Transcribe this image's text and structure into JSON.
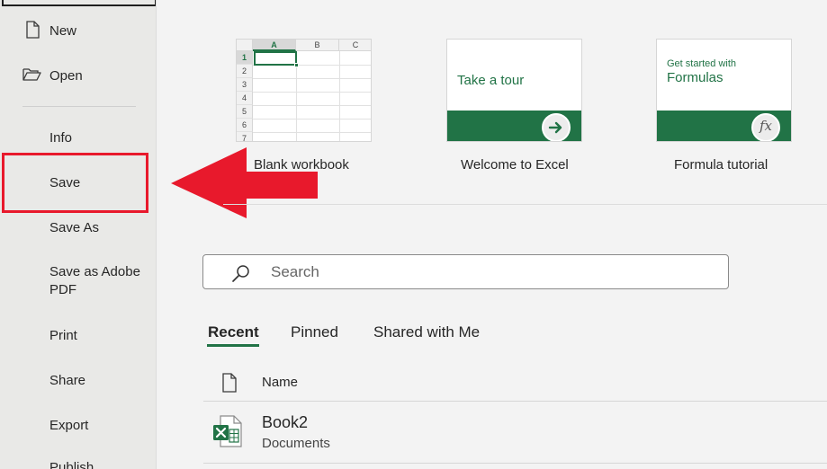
{
  "sidebar": {
    "new_label": "New",
    "open_label": "Open",
    "info_label": "Info",
    "save_label": "Save",
    "save_as_label": "Save As",
    "save_pdf_label": "Save as Adobe PDF",
    "print_label": "Print",
    "share_label": "Share",
    "export_label": "Export",
    "publish_label": "Publish"
  },
  "templates": [
    {
      "label": "Blank workbook"
    },
    {
      "label": "Welcome to Excel",
      "thumb_text": "Take a tour"
    },
    {
      "label": "Formula tutorial",
      "thumb_small": "Get started with",
      "thumb_big": "Formulas",
      "thumb_glyph": "fx"
    }
  ],
  "blank_grid": {
    "columns": [
      "A",
      "B",
      "C"
    ],
    "rows": [
      "1",
      "2",
      "3",
      "4",
      "5",
      "6",
      "7"
    ]
  },
  "search": {
    "placeholder": "Search",
    "value": ""
  },
  "tabs": {
    "recent": "Recent",
    "pinned": "Pinned",
    "shared": "Shared with Me"
  },
  "list": {
    "column_name": "Name",
    "files": [
      {
        "name": "Book2",
        "location": "Documents"
      }
    ]
  },
  "colors": {
    "accent": "#217346",
    "highlight": "#e8192c"
  },
  "icons": {
    "new": "new-document-icon",
    "open": "folder-open-icon",
    "search": "search-icon",
    "file_type": "document-icon",
    "excel": "excel-file-icon",
    "arrow": "arrow-right-icon",
    "annotation": "red-arrow-icon"
  }
}
